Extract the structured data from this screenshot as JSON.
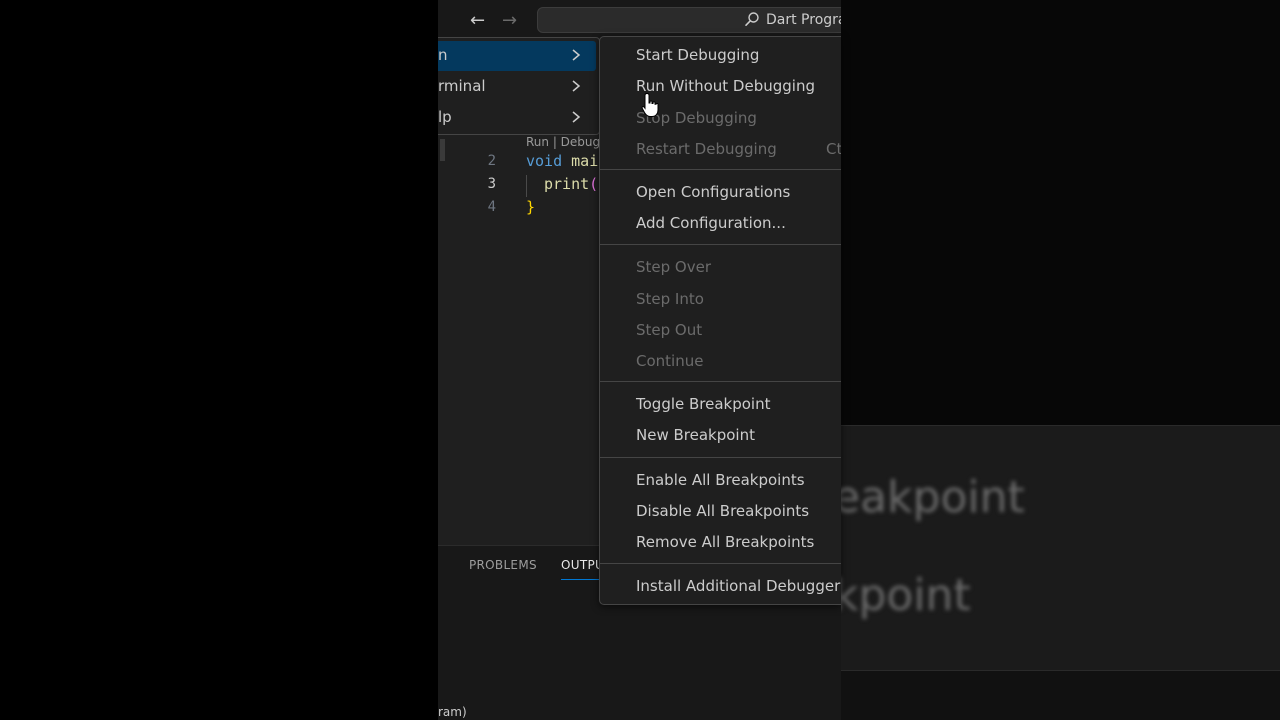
{
  "titlebar": {
    "command_center_label": "Dart Program"
  },
  "menubar": {
    "items": [
      {
        "label": "n"
      },
      {
        "label": "rminal"
      },
      {
        "label": "lp"
      }
    ]
  },
  "editor": {
    "codelens": "Run | Debug",
    "line_numbers": [
      "2",
      "3",
      "4"
    ],
    "code": {
      "line2_kw": "void",
      "line2_fn": " mai",
      "line3_fn": "print",
      "line3_paren": "(",
      "line4_brace": "}"
    }
  },
  "panel": {
    "tabs": [
      "PROBLEMS",
      "OUTPUT"
    ]
  },
  "statusbar": {
    "text": "ram)"
  },
  "run_menu": {
    "groups": [
      [
        {
          "label": "Start Debugging",
          "enabled": true
        },
        {
          "label": "Run Without Debugging",
          "enabled": true
        },
        {
          "label": "Stop Debugging",
          "enabled": false
        },
        {
          "label": "Restart Debugging",
          "enabled": false,
          "shortcut": "Ct"
        }
      ],
      [
        {
          "label": "Open Configurations",
          "enabled": true
        },
        {
          "label": "Add Configuration...",
          "enabled": true
        }
      ],
      [
        {
          "label": "Step Over",
          "enabled": false
        },
        {
          "label": "Step Into",
          "enabled": false
        },
        {
          "label": "Step Out",
          "enabled": false
        },
        {
          "label": "Continue",
          "enabled": false
        }
      ],
      [
        {
          "label": "Toggle Breakpoint",
          "enabled": true
        },
        {
          "label": "New Breakpoint",
          "enabled": true
        }
      ],
      [
        {
          "label": "Enable All Breakpoints",
          "enabled": true
        },
        {
          "label": "Disable All Breakpoints",
          "enabled": true
        },
        {
          "label": "Remove All Breakpoints",
          "enabled": true
        }
      ],
      [
        {
          "label": "Install Additional Debuggers...",
          "enabled": true
        }
      ]
    ]
  },
  "background": {
    "ghost_text_1": "eakpoint",
    "ghost_text_2": "kpoint"
  },
  "colors": {
    "menu_bg": "#1f1f1f",
    "active_menubar_item": "#04395e",
    "disabled_text": "#6b6b6b",
    "accent": "#0078d4"
  },
  "icons": [
    "arrow-left-icon",
    "arrow-right-icon",
    "search-icon",
    "chevron-right-icon",
    "hand-cursor-icon"
  ]
}
